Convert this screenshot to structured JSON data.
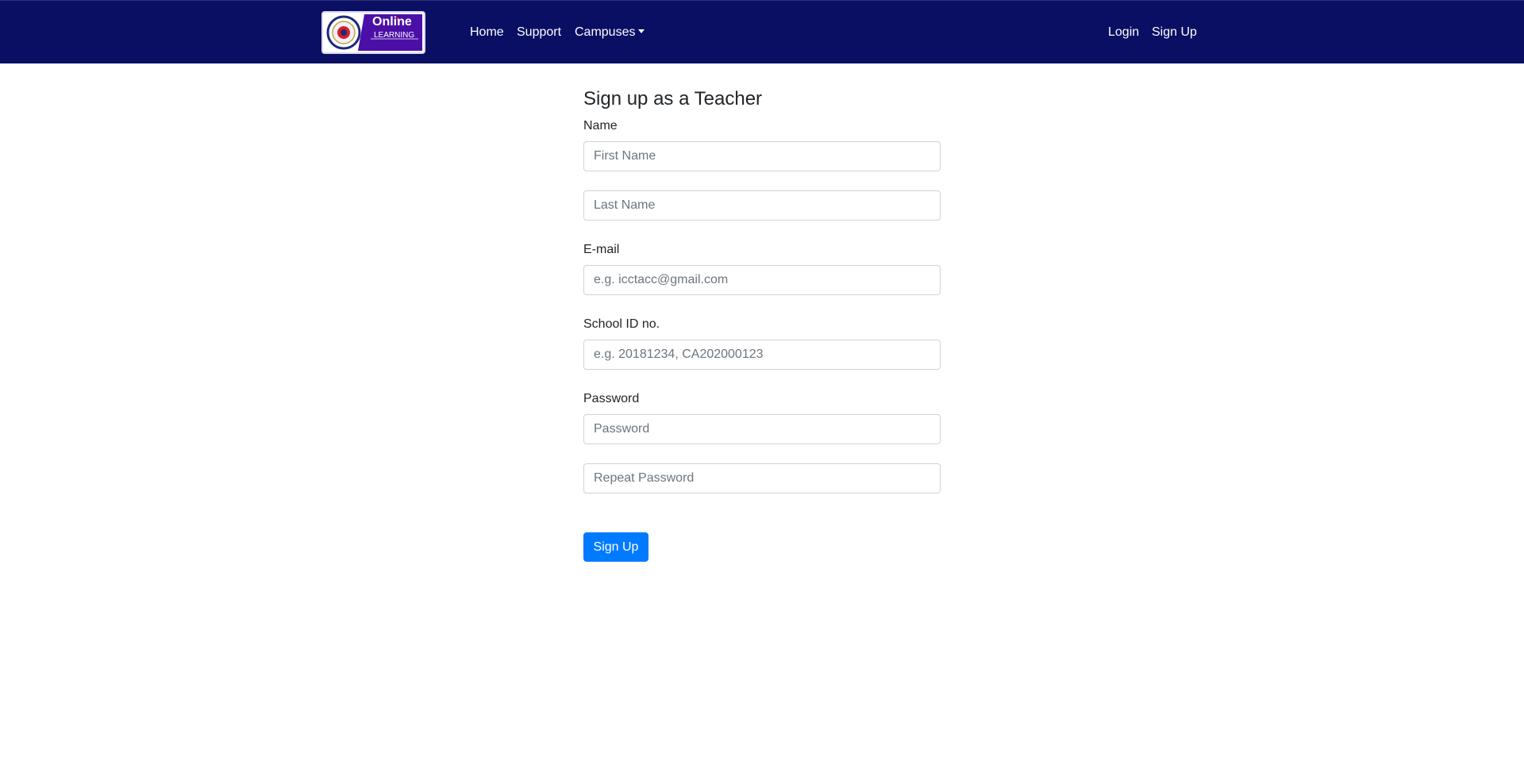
{
  "navbar": {
    "logo": {
      "icon": "school-seal-logo",
      "line1": "Online",
      "line2": "LEARNING",
      "colors": {
        "panel": "#4b0fa8",
        "seal_ring": "#1a2a7a",
        "accent_red": "#d61f26"
      }
    },
    "links": {
      "home": "Home",
      "support": "Support",
      "campuses": "Campuses",
      "login": "Login",
      "signup": "Sign Up"
    },
    "background": "#0a0f64"
  },
  "form": {
    "title": "Sign up as a Teacher",
    "name_label": "Name",
    "first_name_placeholder": "First Name",
    "last_name_placeholder": "Last Name",
    "email_label": "E-mail",
    "email_placeholder": "e.g. icctacc@gmail.com",
    "school_id_label": "School ID no.",
    "school_id_placeholder": "e.g. 20181234, CA202000123",
    "password_label": "Password",
    "password_placeholder": "Password",
    "repeat_password_placeholder": "Repeat Password",
    "submit_label": "Sign Up",
    "submit_color": "#007bff"
  }
}
